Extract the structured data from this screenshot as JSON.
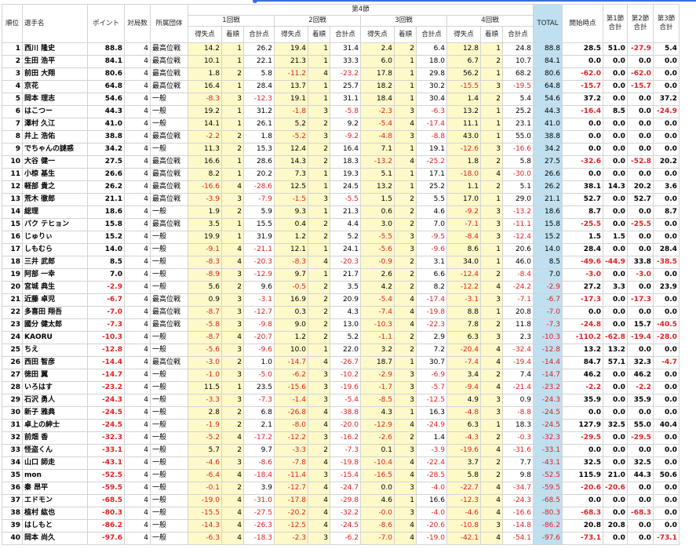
{
  "header": {
    "rank": "順位",
    "name": "選手名",
    "point": "ポイント",
    "matches": "対局数",
    "group": "所属団体",
    "section": "第4節",
    "rounds": [
      "1回戦",
      "2回戦",
      "3回戦",
      "4回戦"
    ],
    "sub": [
      "得失点",
      "着順",
      "合計点"
    ],
    "total": "TOTAL",
    "start": "開始時点",
    "sec1": "第1節\n合計",
    "sec2": "第2節\n合計",
    "sec3": "第3節\n合計"
  },
  "rows": [
    [
      "1",
      "西川 隆史",
      "88.8",
      "4",
      "最高位戦",
      "14.2",
      "1",
      "26.2",
      "19.4",
      "1",
      "31.4",
      "2.4",
      "2",
      "6.4",
      "12.8",
      "1",
      "24.8",
      "88.8",
      "28.5",
      "51.0",
      "-27.9",
      "5.4"
    ],
    [
      "2",
      "生田 浩平",
      "84.1",
      "4",
      "最高位戦",
      "10.1",
      "1",
      "22.1",
      "21.3",
      "1",
      "33.3",
      "6.0",
      "1",
      "18.0",
      "6.7",
      "2",
      "10.7",
      "84.1",
      "0.0",
      "0.0",
      "0.0",
      "0.0"
    ],
    [
      "3",
      "前田 大翔",
      "80.6",
      "4",
      "最高位戦",
      "1.8",
      "2",
      "5.8",
      "-11.2",
      "4",
      "-23.2",
      "17.8",
      "1",
      "29.8",
      "56.2",
      "1",
      "68.2",
      "80.6",
      "-62.0",
      "0.0",
      "-62.0",
      "0.0"
    ],
    [
      "4",
      "京花",
      "64.8",
      "4",
      "最高位戦",
      "16.4",
      "1",
      "28.4",
      "13.7",
      "1",
      "25.7",
      "18.2",
      "1",
      "30.2",
      "-15.5",
      "3",
      "-19.5",
      "64.8",
      "-15.7",
      "0.0",
      "-15.7",
      "0.0"
    ],
    [
      "5",
      "岡本 理志",
      "54.6",
      "4",
      "一般",
      "-8.3",
      "3",
      "-12.3",
      "19.1",
      "1",
      "31.1",
      "18.4",
      "1",
      "30.4",
      "1.4",
      "2",
      "5.4",
      "54.6",
      "37.2",
      "0.0",
      "0.0",
      "37.2"
    ],
    [
      "6",
      "はこつー",
      "44.3",
      "4",
      "一般",
      "19.2",
      "1",
      "31.2",
      "-1.8",
      "3",
      "-5.8",
      "-2.3",
      "3",
      "-6.3",
      "13.2",
      "1",
      "25.2",
      "44.3",
      "-16.4",
      "8.5",
      "0.0",
      "-24.9"
    ],
    [
      "7",
      "澤村 久江",
      "41.0",
      "4",
      "一般",
      "14.1",
      "1",
      "26.1",
      "5.2",
      "2",
      "9.2",
      "-5.4",
      "4",
      "-17.4",
      "11.1",
      "1",
      "23.1",
      "41.0",
      "0.0",
      "0.0",
      "0.0",
      "0.0"
    ],
    [
      "8",
      "井上 浩佑",
      "38.8",
      "4",
      "最高位戦",
      "-2.2",
      "2",
      "1.8",
      "-5.2",
      "3",
      "-9.2",
      "-4.8",
      "3",
      "-8.8",
      "43.0",
      "1",
      "55.0",
      "38.8",
      "0.0",
      "0.0",
      "0.0",
      "0.0"
    ],
    [
      "9",
      "でちゃんの謎惑",
      "34.2",
      "4",
      "一般",
      "11.3",
      "2",
      "15.3",
      "12.4",
      "2",
      "16.4",
      "7.1",
      "1",
      "19.1",
      "-12.6",
      "3",
      "-16.6",
      "34.2",
      "0.0",
      "0.0",
      "0.0",
      "0.0"
    ],
    [
      "10",
      "大谷 健一",
      "27.5",
      "4",
      "最高位戦",
      "16.6",
      "1",
      "28.6",
      "14.3",
      "2",
      "18.3",
      "-13.2",
      "4",
      "-25.2",
      "1.8",
      "2",
      "5.8",
      "27.5",
      "-32.6",
      "0.0",
      "-52.8",
      "20.2"
    ],
    [
      "11",
      "小椋 基生",
      "26.6",
      "4",
      "最高位戦",
      "8.2",
      "1",
      "20.2",
      "7.3",
      "1",
      "19.3",
      "5.1",
      "1",
      "17.1",
      "-18.0",
      "4",
      "-30.0",
      "26.6",
      "0.0",
      "0.0",
      "0.0",
      "0.0"
    ],
    [
      "12",
      "軽部 貴之",
      "26.2",
      "4",
      "最高位戦",
      "-16.6",
      "4",
      "-28.6",
      "12.5",
      "1",
      "24.5",
      "13.2",
      "1",
      "25.2",
      "1.1",
      "2",
      "5.1",
      "26.2",
      "38.1",
      "14.3",
      "20.2",
      "3.6"
    ],
    [
      "13",
      "荒木 徹郎",
      "21.1",
      "4",
      "最高位戦",
      "-3.9",
      "3",
      "-7.9",
      "-1.5",
      "3",
      "-5.5",
      "1.5",
      "2",
      "5.5",
      "17.0",
      "1",
      "29.0",
      "21.1",
      "52.7",
      "0.0",
      "52.7",
      "0.0"
    ],
    [
      "14",
      "総理",
      "18.6",
      "4",
      "一般",
      "1.9",
      "2",
      "5.9",
      "9.3",
      "1",
      "21.3",
      "0.6",
      "2",
      "4.6",
      "-9.2",
      "3",
      "-13.2",
      "18.6",
      "8.7",
      "0.0",
      "0.0",
      "8.7"
    ],
    [
      "15",
      "パク テヒョン",
      "15.8",
      "4",
      "最高位戦",
      "3.5",
      "1",
      "15.5",
      "0.4",
      "2",
      "4.4",
      "3.0",
      "2",
      "7.0",
      "-7.1",
      "3",
      "-11.1",
      "15.8",
      "-25.5",
      "0.0",
      "-25.5",
      "0.0"
    ],
    [
      "16",
      "じゅりぃ",
      "15.2",
      "4",
      "一般",
      "19.9",
      "1",
      "31.9",
      "1.2",
      "2",
      "5.2",
      "-5.5",
      "3",
      "-9.5",
      "-8.4",
      "3",
      "-12.4",
      "15.2",
      "1.5",
      "1.5",
      "0.0",
      "0.0"
    ],
    [
      "17",
      "しもむら",
      "14.0",
      "4",
      "一般",
      "-9.1",
      "4",
      "-21.1",
      "12.1",
      "1",
      "24.1",
      "-5.6",
      "3",
      "-9.6",
      "8.6",
      "1",
      "20.6",
      "14.0",
      "28.4",
      "0.0",
      "0.0",
      "28.4"
    ],
    [
      "18",
      "三井 武郎",
      "8.5",
      "4",
      "一般",
      "-8.3",
      "4",
      "-20.3",
      "-8.3",
      "4",
      "-20.3",
      "-0.9",
      "2",
      "3.1",
      "34.0",
      "1",
      "46.0",
      "8.5",
      "-49.6",
      "-44.9",
      "33.8",
      "-38.5"
    ],
    [
      "19",
      "阿部 一幸",
      "7.0",
      "4",
      "一般",
      "-8.9",
      "3",
      "-12.9",
      "9.7",
      "1",
      "21.7",
      "2.6",
      "2",
      "6.6",
      "-12.4",
      "2",
      "-8.4",
      "7.0",
      "-3.0",
      "0.0",
      "-3.0",
      "0.0"
    ],
    [
      "20",
      "宮城 典生",
      "-2.9",
      "4",
      "一般",
      "5.6",
      "2",
      "9.6",
      "-0.5",
      "2",
      "3.5",
      "4.2",
      "2",
      "8.2",
      "-12.2",
      "4",
      "-24.2",
      "-2.9",
      "27.2",
      "3.3",
      "0.0",
      "23.9"
    ],
    [
      "21",
      "近藤 卓児",
      "-6.7",
      "4",
      "最高位戦",
      "0.9",
      "3",
      "-3.1",
      "16.9",
      "2",
      "20.9",
      "-5.4",
      "4",
      "-17.4",
      "-3.1",
      "3",
      "-7.1",
      "-6.7",
      "-17.3",
      "0.0",
      "-17.3",
      "0.0"
    ],
    [
      "22",
      "多喜田 翔吾",
      "-7.0",
      "4",
      "最高位戦",
      "-8.7",
      "3",
      "-12.7",
      "0.3",
      "2",
      "4.3",
      "-7.4",
      "4",
      "-19.8",
      "8.8",
      "1",
      "20.8",
      "-7.0",
      "0.0",
      "0.0",
      "0.0",
      "0.0"
    ],
    [
      "23",
      "國分 健太郎",
      "-7.3",
      "4",
      "最高位戦",
      "-5.8",
      "3",
      "-9.8",
      "9.0",
      "2",
      "13.0",
      "-10.3",
      "4",
      "-22.3",
      "7.8",
      "2",
      "11.8",
      "-7.3",
      "-24.8",
      "0.0",
      "15.7",
      "-40.5"
    ],
    [
      "24",
      "KAORU",
      "-10.3",
      "4",
      "一般",
      "-8.7",
      "4",
      "-20.7",
      "1.2",
      "2",
      "5.2",
      "-1.1",
      "2",
      "2.9",
      "6.3",
      "3",
      "2.3",
      "-10.3",
      "-110.2",
      "-62.8",
      "-19.4",
      "-28.0"
    ],
    [
      "25",
      "ちえ",
      "-12.8",
      "4",
      "一般",
      "-5.6",
      "3",
      "-9.6",
      "10.0",
      "1",
      "22.0",
      "3.2",
      "2",
      "7.2",
      "-20.4",
      "4",
      "-32.4",
      "-12.8",
      "13.2",
      "13.2",
      "0.0",
      "0.0"
    ],
    [
      "26",
      "西田 智彦",
      "-14.4",
      "4",
      "最高位戦",
      "-3.0",
      "2",
      "1.0",
      "-14.7",
      "4",
      "-26.7",
      "18.7",
      "1",
      "30.7",
      "-7.4",
      "4",
      "-19.4",
      "-14.4",
      "84.7",
      "57.1",
      "32.3",
      "-4.7"
    ],
    [
      "27",
      "徳田 翼",
      "-14.7",
      "4",
      "一般",
      "-1.0",
      "3",
      "-5.0",
      "-6.2",
      "3",
      "-10.2",
      "-2.9",
      "3",
      "-6.9",
      "3.4",
      "2",
      "7.4",
      "-14.7",
      "46.2",
      "0.0",
      "46.2",
      "0.0"
    ],
    [
      "28",
      "いろはす",
      "-23.2",
      "4",
      "一般",
      "11.5",
      "1",
      "23.5",
      "-15.6",
      "3",
      "-19.6",
      "-1.7",
      "3",
      "-5.7",
      "-9.4",
      "4",
      "-21.4",
      "-23.2",
      "-2.2",
      "0.0",
      "-2.2",
      "0.0"
    ],
    [
      "29",
      "石沢 勇人",
      "-24.3",
      "4",
      "一般",
      "-3.3",
      "3",
      "-7.3",
      "-1.4",
      "3",
      "-5.4",
      "-8.5",
      "3",
      "-12.5",
      "4.9",
      "3",
      "0.9",
      "-24.3",
      "35.9",
      "0.0",
      "35.9",
      "0.0"
    ],
    [
      "30",
      "新子 雅典",
      "-24.5",
      "4",
      "一般",
      "2.8",
      "2",
      "6.8",
      "-26.8",
      "4",
      "-38.8",
      "4.3",
      "1",
      "16.3",
      "-4.8",
      "3",
      "-8.8",
      "-24.5",
      "0.0",
      "0.0",
      "0.0",
      "0.0"
    ],
    [
      "31",
      "卓上の紳士",
      "-24.5",
      "4",
      "一般",
      "-1.9",
      "2",
      "2.1",
      "-8.0",
      "4",
      "-20.0",
      "-12.9",
      "4",
      "-24.9",
      "6.3",
      "1",
      "18.3",
      "-24.5",
      "127.9",
      "32.5",
      "55.0",
      "40.4"
    ],
    [
      "32",
      "前畑 香",
      "-32.3",
      "4",
      "一般",
      "-5.2",
      "4",
      "-17.2",
      "-12.2",
      "3",
      "-16.2",
      "-2.6",
      "2",
      "1.4",
      "-4.3",
      "2",
      "-0.3",
      "-32.3",
      "-29.5",
      "0.0",
      "-29.5",
      "0.0"
    ],
    [
      "33",
      "怪盗くん",
      "-33.1",
      "4",
      "一般",
      "5.7",
      "2",
      "9.7",
      "-3.3",
      "2",
      "-7.3",
      "0.1",
      "3",
      "-3.9",
      "-19.6",
      "4",
      "-31.6",
      "-33.1",
      "0.0",
      "0.0",
      "0.0",
      "0.0"
    ],
    [
      "34",
      "山口 師走",
      "-43.1",
      "4",
      "一般",
      "-4.6",
      "3",
      "-8.6",
      "-7.8",
      "4",
      "-19.8",
      "-10.4",
      "4",
      "-22.4",
      "3.7",
      "2",
      "7.7",
      "-43.1",
      "32.5",
      "0.0",
      "32.5",
      "0.0"
    ],
    [
      "35",
      "mon",
      "-52.5",
      "4",
      "一般",
      "-6.4",
      "4",
      "-18.4",
      "-11.4",
      "3",
      "-15.4",
      "-16.5",
      "4",
      "-28.5",
      "5.8",
      "2",
      "9.8",
      "-52.5",
      "115.9",
      "21.0",
      "44.3",
      "50.6"
    ],
    [
      "36",
      "秦 昂平",
      "-59.5",
      "4",
      "一般",
      "-0.1",
      "2",
      "3.9",
      "-12.7",
      "4",
      "-24.7",
      "0.0",
      "3",
      "-4.0",
      "-22.7",
      "4",
      "-34.7",
      "-59.5",
      "-20.6",
      "-20.6",
      "0.0",
      "0.0"
    ],
    [
      "37",
      "エドモン",
      "-68.5",
      "4",
      "一般",
      "-19.0",
      "4",
      "-31.0",
      "-17.8",
      "4",
      "-29.8",
      "4.6",
      "1",
      "16.6",
      "-12.3",
      "4",
      "-24.3",
      "-68.5",
      "0.0",
      "0.0",
      "0.0",
      "0.0"
    ],
    [
      "38",
      "植村 紘也",
      "-80.3",
      "4",
      "一般",
      "-15.5",
      "4",
      "-27.5",
      "-20.2",
      "4",
      "-32.2",
      "-0.0",
      "3",
      "-4.0",
      "-4.6",
      "4",
      "-16.6",
      "-80.3",
      "-68.3",
      "0.0",
      "-68.3",
      "0.0"
    ],
    [
      "39",
      "はしもと",
      "-86.2",
      "4",
      "一般",
      "-14.3",
      "4",
      "-26.3",
      "-12.5",
      "4",
      "-24.5",
      "-8.6",
      "4",
      "-20.6",
      "-10.8",
      "3",
      "-14.8",
      "-86.2",
      "20.8",
      "20.8",
      "0.0",
      "0.0"
    ],
    [
      "40",
      "岡本 尚久",
      "-97.6",
      "4",
      "一般",
      "-6.3",
      "4",
      "-18.3",
      "-2.3",
      "3",
      "-6.2",
      "-7.0",
      "4",
      "-19.0",
      "-42.1",
      "4",
      "-54.1",
      "-97.6",
      "-73.1",
      "0.0",
      "0.0",
      "-73.1"
    ]
  ]
}
